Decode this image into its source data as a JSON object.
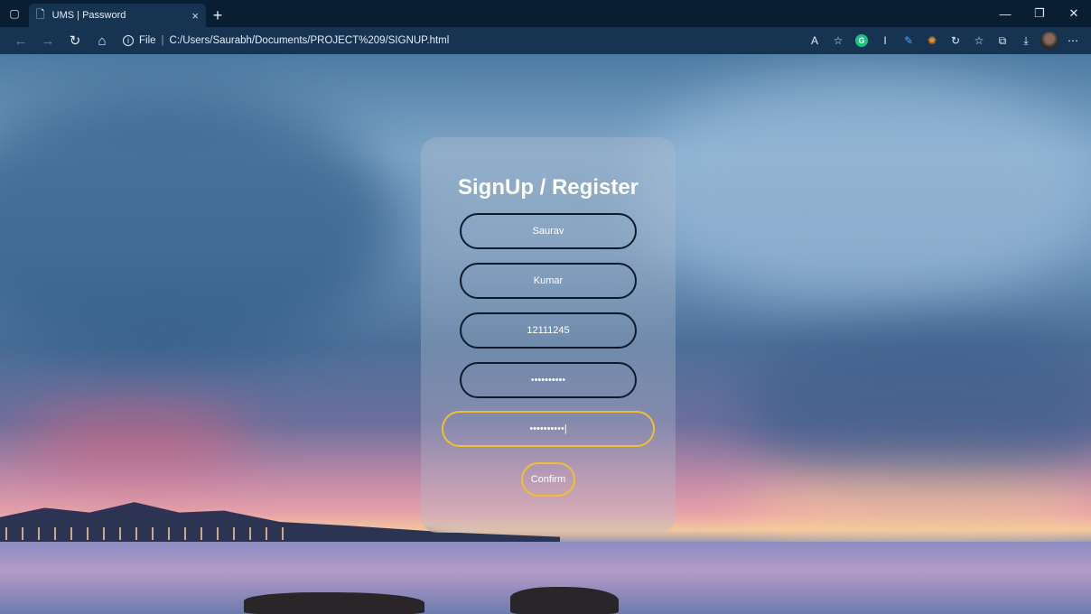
{
  "browser": {
    "tab_title": "UMS | Password",
    "tab_close": "×",
    "new_tab": "+",
    "address_scheme": "File",
    "address_separator": "|",
    "address_url": "C:/Users/Saurabh/Documents/PROJECT%209/SIGNUP.html",
    "extension_icon_g": "G",
    "read_aloud": "A",
    "controls": {
      "minimize": "—",
      "restore": "❐",
      "close": "✕"
    },
    "nav": {
      "back": "←",
      "forward": "→",
      "refresh": "↻",
      "home": "⌂"
    }
  },
  "form": {
    "title": "SignUp / Register",
    "fields": [
      {
        "value": "Saurav"
      },
      {
        "value": "Kumar"
      },
      {
        "value": "12111245"
      },
      {
        "value": "••••••••••"
      },
      {
        "value": "••••••••••|"
      }
    ],
    "confirm_label": "Confirm"
  },
  "colors": {
    "focus_border": "#f0c030",
    "field_border": "#0e1a2b",
    "toolbar": "#163452"
  }
}
